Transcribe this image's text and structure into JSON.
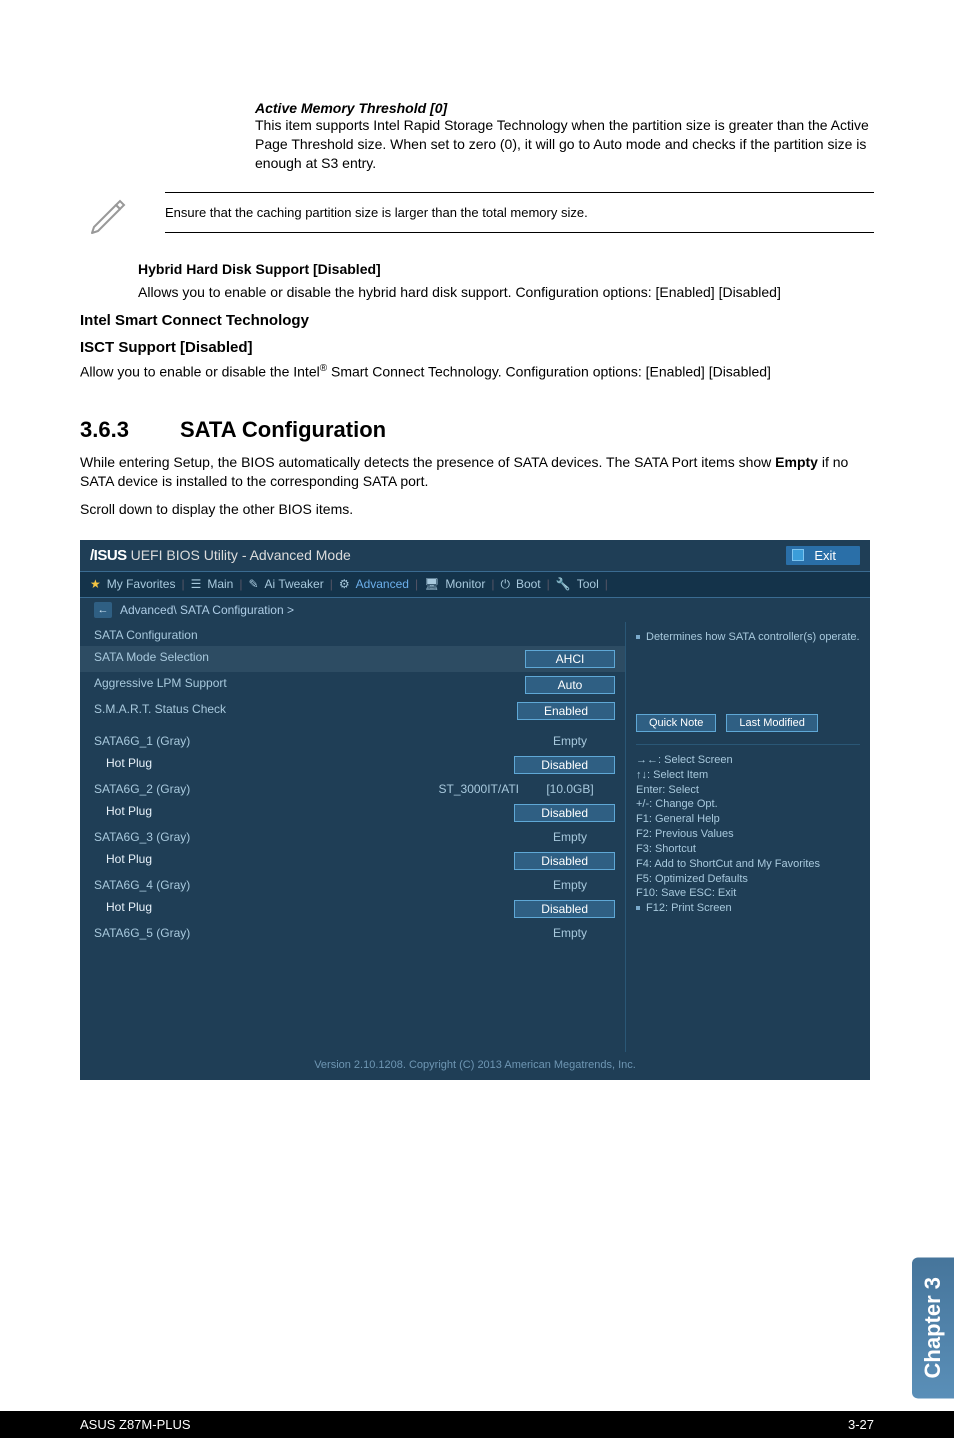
{
  "indent": {
    "title": "Active Memory Threshold [0]",
    "desc": "This item supports Intel Rapid Storage Technology when the partition size is greater than the Active Page Threshold size. When set to zero (0), it will go to Auto mode and checks if the partition size is enough at S3 entry."
  },
  "note": "Ensure that the caching partition size is larger than the total memory size.",
  "hybrid": {
    "title": "Hybrid Hard Disk Support [Disabled]",
    "desc": "Allows you to enable or disable the hybrid hard disk support. Configuration options: [Enabled] [Disabled]"
  },
  "intel_smart": "Intel Smart Connect Technology",
  "isct": {
    "title": "ISCT Support [Disabled]",
    "desc1": "Allow you to enable or disable the Intel",
    "desc2": " Smart Connect Technology. Configuration options: [Enabled] [Disabled]"
  },
  "section": {
    "num": "3.6.3",
    "title": "SATA Configuration",
    "p1a": "While entering Setup, the BIOS automatically detects the presence of SATA devices. The SATA Port items show ",
    "p1b": "Empty",
    "p1c": " if no SATA device is installed to the corresponding SATA port.",
    "p2": "Scroll down to display the other BIOS items."
  },
  "bios": {
    "titlebar_a": "UEFI BIOS Utility - Advanced Mode",
    "exit": "Exit",
    "tabs": {
      "fav": "My Favorites",
      "main": "Main",
      "ai": "Ai Tweaker",
      "adv": "Advanced",
      "mon": "Monitor",
      "boot": "Boot",
      "tool": "Tool"
    },
    "breadcrumb": "Advanced\\ SATA Configuration >",
    "hdr": "SATA Configuration",
    "rows": {
      "mode": "SATA Mode Selection",
      "mode_v": "AHCI",
      "lpm": "Aggressive LPM Support",
      "lpm_v": "Auto",
      "smart": "S.M.A.R.T. Status Check",
      "smart_v": "Enabled",
      "s1": "SATA6G_1 (Gray)",
      "s1_v": "Empty",
      "hp1": "Hot Plug",
      "hp1_v": "Disabled",
      "s2": "SATA6G_2 (Gray)",
      "s2_m": "ST_3000IT/ATI",
      "s2_v": "[10.0GB]",
      "hp2": "Hot Plug",
      "hp2_v": "Disabled",
      "s3": "SATA6G_3 (Gray)",
      "s3_v": "Empty",
      "hp3": "Hot Plug",
      "hp3_v": "Disabled",
      "s4": "SATA6G_4 (Gray)",
      "s4_v": "Empty",
      "hp4": "Hot Plug",
      "hp4_v": "Disabled",
      "s5": "SATA6G_5 (Gray)",
      "s5_v": "Empty"
    },
    "right_desc": "Determines how SATA controller(s) operate.",
    "qn": "Quick Note",
    "lm": "Last Modified",
    "nav": {
      "l1": "→←: Select Screen",
      "l2": "↑↓: Select Item",
      "l3": "Enter: Select",
      "l4": "+/-: Change Opt.",
      "l5": "F1: General Help",
      "l6": "F2: Previous Values",
      "l7": "F3: Shortcut",
      "l8": "F4: Add to ShortCut and My Favorites",
      "l9": "F5: Optimized Defaults",
      "l10": "F10: Save  ESC: Exit",
      "l11": "F12: Print Screen"
    },
    "footer": "Version 2.10.1208. Copyright (C) 2013 American Megatrends, Inc."
  },
  "side_tab": "Chapter 3",
  "footer_left": "ASUS Z87M-PLUS",
  "footer_right": "3-27"
}
